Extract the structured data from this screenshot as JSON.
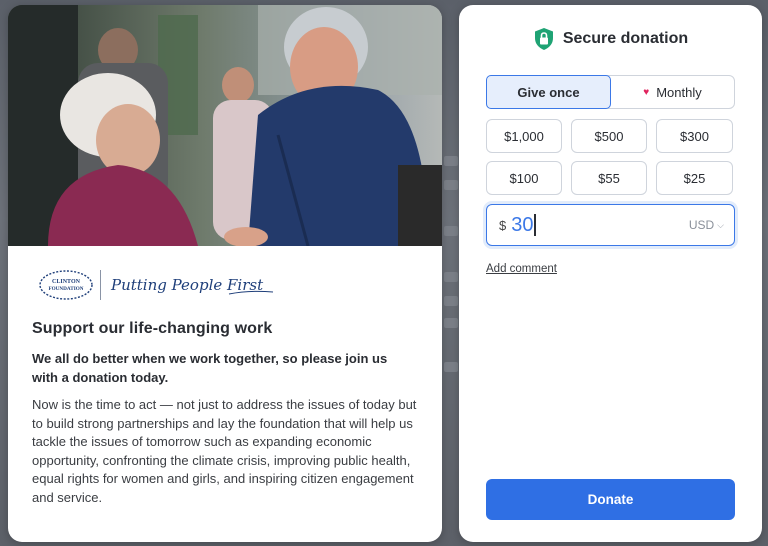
{
  "brand": {
    "foundation_logo_text": "CLINTON FOUNDATION",
    "signature_text": "Putting People First"
  },
  "content": {
    "headline": "Support our life-changing work",
    "subhead": "We all do better when we work together, so please join us with a donation today.",
    "body": "Now is the time to act — not just to address the issues of today but to build strong partnerships and lay the foundation that will help us tackle the issues of tomorrow such as expanding economic opportunity, confronting the climate crisis, improving public health, equal rights for women and girls, and inspiring citizen engagement and service."
  },
  "donation": {
    "title": "Secure donation",
    "frequency": {
      "once_label": "Give once",
      "monthly_label": "Monthly",
      "selected": "once"
    },
    "amounts": [
      "$1,000",
      "$500",
      "$300",
      "$100",
      "$55",
      "$25"
    ],
    "currency_symbol": "$",
    "amount_value": "30",
    "currency": "USD",
    "add_comment_label": "Add comment",
    "donate_label": "Donate"
  },
  "colors": {
    "accent": "#2f6fe4",
    "shield": "#1fa374",
    "heart": "#e0245e",
    "navy_logo": "#1f3f7a"
  },
  "icons": {
    "title_icon": "shield-lock-icon",
    "monthly_icon": "heart-icon",
    "currency_icon": "chevron-down-icon"
  }
}
